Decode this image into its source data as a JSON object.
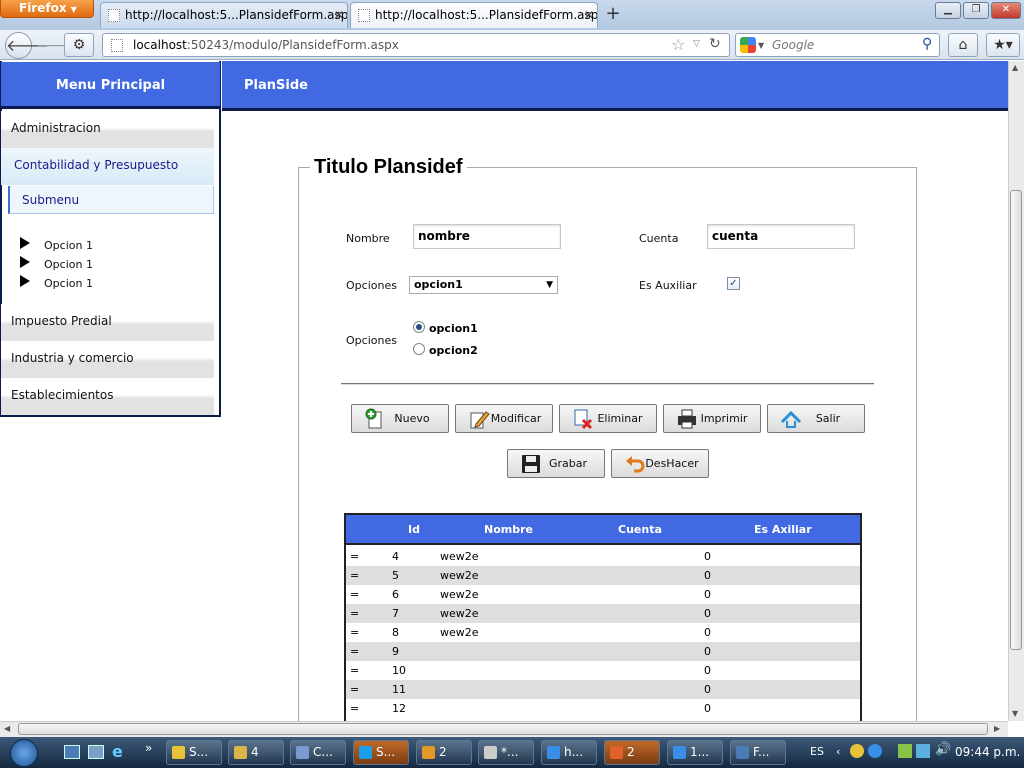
{
  "browser": {
    "app_button": "Firefox",
    "tabs": [
      {
        "title": "http://localhost:5...PlansidefForm.aspx",
        "active": false
      },
      {
        "title": "http://localhost:5...PlansidefForm.aspx",
        "active": true
      }
    ],
    "url_host": "localhost",
    "url_rest": ":50243/modulo/PlansidefForm.aspx",
    "search_placeholder": "Google"
  },
  "sidebar": {
    "header": "Menu Principal",
    "items": [
      {
        "label": "Administracion"
      },
      {
        "label": "Contabilidad y Presupuesto"
      },
      {
        "label": "Impuesto Predial"
      },
      {
        "label": "Industria y comercio"
      },
      {
        "label": "Establecimientos"
      }
    ],
    "submenu": "Submenu",
    "options": [
      "Opcion 1",
      "Opcion 1",
      "Opcion 1"
    ]
  },
  "page": {
    "header": "PlanSide",
    "form_title": "Titulo Plansidef",
    "labels": {
      "nombre": "Nombre",
      "cuenta": "Cuenta",
      "opciones_select": "Opciones",
      "es_auxiliar": "Es Auxiliar",
      "opciones_radio": "Opciones"
    },
    "values": {
      "nombre": "nombre",
      "cuenta": "cuenta",
      "select": "opcion1",
      "es_auxiliar_checked": true
    },
    "radios": [
      {
        "label": "opcion1",
        "checked": true
      },
      {
        "label": "opcion2",
        "checked": false
      }
    ],
    "buttons": {
      "nuevo": "Nuevo",
      "modificar": "Modificar",
      "eliminar": "Eliminar",
      "imprimir": "Imprimir",
      "salir": "Salir",
      "grabar": "Grabar",
      "deshacer": "DesHacer"
    }
  },
  "grid": {
    "headers": [
      "Id",
      "Nombre",
      "Cuenta",
      "Es Axiliar"
    ],
    "rows": [
      {
        "sel": "=",
        "id": "4",
        "nombre": "wew2e",
        "cuenta": "0"
      },
      {
        "sel": "=",
        "id": "5",
        "nombre": "wew2e",
        "cuenta": "0"
      },
      {
        "sel": "=",
        "id": "6",
        "nombre": "wew2e",
        "cuenta": "0"
      },
      {
        "sel": "=",
        "id": "7",
        "nombre": "wew2e",
        "cuenta": "0"
      },
      {
        "sel": "=",
        "id": "8",
        "nombre": "wew2e",
        "cuenta": "0"
      },
      {
        "sel": "=",
        "id": "9",
        "nombre": "",
        "cuenta": "0"
      },
      {
        "sel": "=",
        "id": "10",
        "nombre": "",
        "cuenta": "0"
      },
      {
        "sel": "=",
        "id": "11",
        "nombre": "",
        "cuenta": "0"
      },
      {
        "sel": "=",
        "id": "12",
        "nombre": "",
        "cuenta": "0"
      }
    ]
  },
  "taskbar": {
    "items": [
      {
        "label": "S..."
      },
      {
        "label": "4"
      },
      {
        "label": "C..."
      },
      {
        "label": "S..."
      },
      {
        "label": "2"
      },
      {
        "label": "*..."
      },
      {
        "label": "h..."
      },
      {
        "label": "2"
      },
      {
        "label": "1..."
      },
      {
        "label": "F..."
      }
    ],
    "lang": "ES",
    "clock": "09:44 p.m."
  },
  "colors": {
    "header_blue": "#4169e1",
    "header_border": "#0a1a4a",
    "row_alt": "#dedede"
  }
}
